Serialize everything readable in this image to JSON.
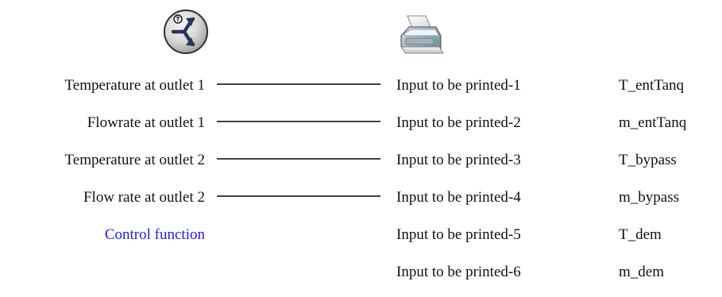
{
  "icons": {
    "diverter": "diverter-icon",
    "printer": "printer-icon"
  },
  "left_labels": [
    {
      "label": "Temperature at outlet 1",
      "type": "output"
    },
    {
      "label": "Flowrate at outlet 1",
      "type": "output"
    },
    {
      "label": "Temperature at outlet 2",
      "type": "output"
    },
    {
      "label": "Flow rate at outlet 2",
      "type": "output"
    },
    {
      "label": "Control function",
      "type": "link"
    }
  ],
  "printer_inputs": [
    {
      "label": "Input to be printed-1",
      "variable": "T_entTanq"
    },
    {
      "label": "Input to be printed-2",
      "variable": "m_entTanq"
    },
    {
      "label": "Input to be printed-3",
      "variable": "T_bypass"
    },
    {
      "label": "Input to be printed-4",
      "variable": "m_bypass"
    },
    {
      "label": "Input to be printed-5",
      "variable": "T_dem"
    },
    {
      "label": "Input to be printed-6",
      "variable": "m_dem"
    }
  ],
  "colors": {
    "text": "#111111",
    "link": "#1f18ff",
    "connector": "#000000"
  }
}
